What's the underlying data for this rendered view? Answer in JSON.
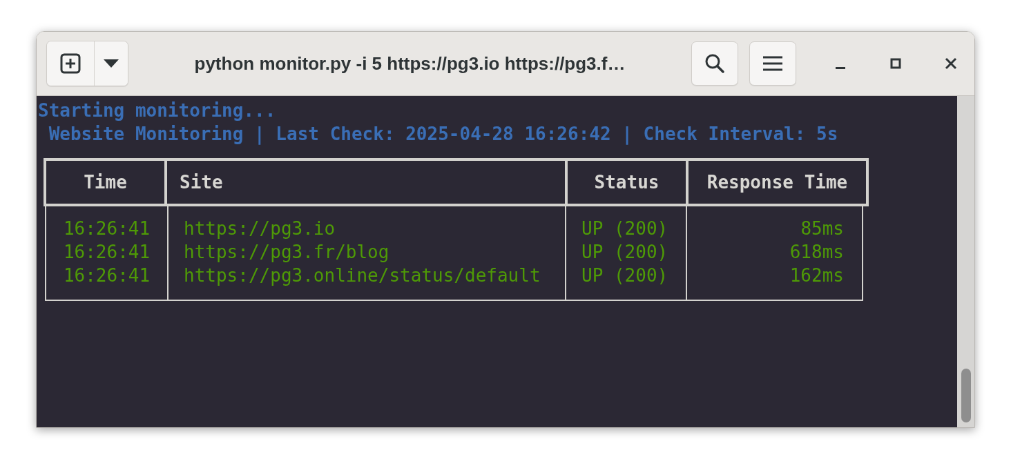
{
  "window": {
    "title": "python monitor.py -i 5 https://pg3.io https://pg3.f…"
  },
  "terminal": {
    "lines": [
      "Starting monitoring...",
      " Website Monitoring | Last Check: 2025-04-28 16:26:42 | Check Interval: 5s"
    ],
    "table": {
      "columns": [
        "Time",
        "Site",
        "Status",
        "Response Time"
      ],
      "rows": [
        [
          "16:26:41",
          "https://pg3.io",
          "UP (200)",
          "85ms"
        ],
        [
          "16:26:41",
          "https://pg3.fr/blog",
          "UP (200)",
          "618ms"
        ],
        [
          "16:26:41",
          "https://pg3.online/status/default",
          "UP (200)",
          "162ms"
        ]
      ]
    }
  }
}
